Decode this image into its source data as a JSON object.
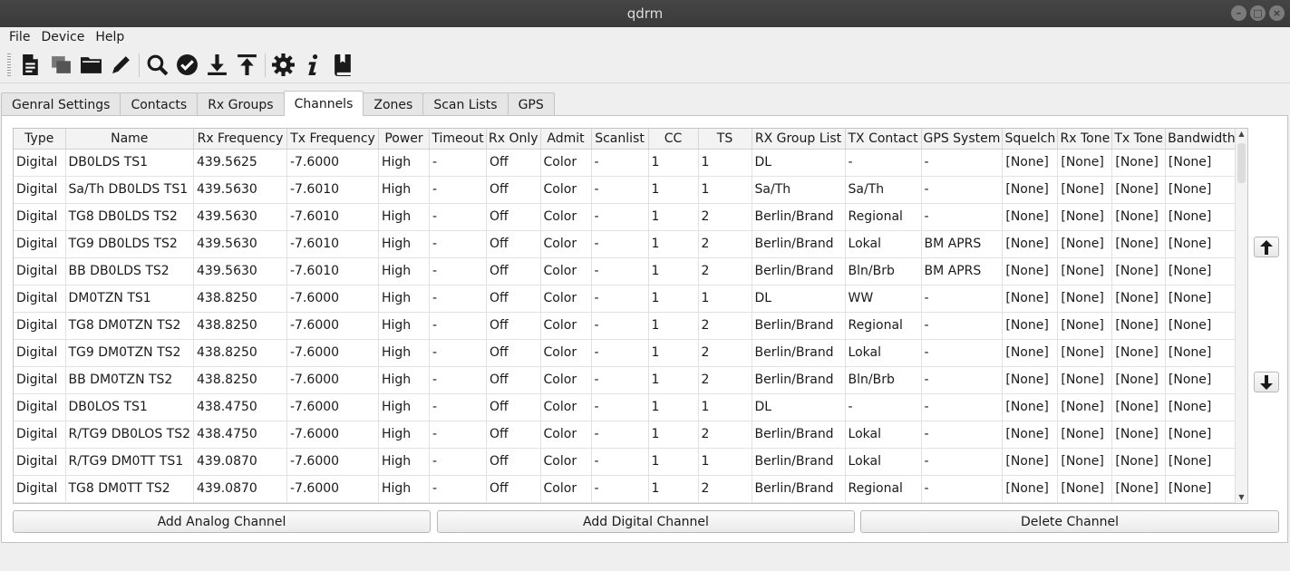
{
  "window": {
    "title": "qdrm"
  },
  "menu": {
    "items": [
      "File",
      "Device",
      "Help"
    ]
  },
  "toolbar": {
    "icons": [
      "new-document-icon",
      "copy-icon",
      "folder-open-icon",
      "pencil-icon",
      "search-icon",
      "check-circle-icon",
      "download-icon",
      "upload-icon",
      "gear-icon",
      "info-icon",
      "book-icon"
    ]
  },
  "tabs": [
    {
      "label": "Genral Settings",
      "active": false
    },
    {
      "label": "Contacts",
      "active": false
    },
    {
      "label": "Rx Groups",
      "active": false
    },
    {
      "label": "Channels",
      "active": true
    },
    {
      "label": "Zones",
      "active": false
    },
    {
      "label": "Scan Lists",
      "active": false
    },
    {
      "label": "GPS",
      "active": false
    }
  ],
  "table": {
    "columns": [
      "Type",
      "Name",
      "Rx Frequency",
      "Tx Frequency",
      "Power",
      "Timeout",
      "Rx Only",
      "Admit",
      "Scanlist",
      "CC",
      "TS",
      "RX Group List",
      "TX Contact",
      "GPS System",
      "Squelch",
      "Rx Tone",
      "Tx Tone",
      "Bandwidth"
    ],
    "rows": [
      [
        "Digital",
        "DB0LDS TS1",
        "439.5625",
        "-7.6000",
        "High",
        "-",
        "Off",
        "Color",
        "-",
        "1",
        "1",
        "DL",
        "-",
        "-",
        "[None]",
        "[None]",
        "[None]",
        "[None]"
      ],
      [
        "Digital",
        "Sa/Th DB0LDS TS1",
        "439.5630",
        "-7.6010",
        "High",
        "-",
        "Off",
        "Color",
        "-",
        "1",
        "1",
        "Sa/Th",
        "Sa/Th",
        "-",
        "[None]",
        "[None]",
        "[None]",
        "[None]"
      ],
      [
        "Digital",
        "TG8 DB0LDS TS2",
        "439.5630",
        "-7.6010",
        "High",
        "-",
        "Off",
        "Color",
        "-",
        "1",
        "2",
        "Berlin/Brand",
        "Regional",
        "-",
        "[None]",
        "[None]",
        "[None]",
        "[None]"
      ],
      [
        "Digital",
        "TG9 DB0LDS TS2",
        "439.5630",
        "-7.6010",
        "High",
        "-",
        "Off",
        "Color",
        "-",
        "1",
        "2",
        "Berlin/Brand",
        "Lokal",
        "BM APRS",
        "[None]",
        "[None]",
        "[None]",
        "[None]"
      ],
      [
        "Digital",
        "BB DB0LDS TS2",
        "439.5630",
        "-7.6010",
        "High",
        "-",
        "Off",
        "Color",
        "-",
        "1",
        "2",
        "Berlin/Brand",
        "Bln/Brb",
        "BM APRS",
        "[None]",
        "[None]",
        "[None]",
        "[None]"
      ],
      [
        "Digital",
        "DM0TZN TS1",
        "438.8250",
        "-7.6000",
        "High",
        "-",
        "Off",
        "Color",
        "-",
        "1",
        "1",
        "DL",
        "WW",
        "-",
        "[None]",
        "[None]",
        "[None]",
        "[None]"
      ],
      [
        "Digital",
        "TG8 DM0TZN TS2",
        "438.8250",
        "-7.6000",
        "High",
        "-",
        "Off",
        "Color",
        "-",
        "1",
        "2",
        "Berlin/Brand",
        "Regional",
        "-",
        "[None]",
        "[None]",
        "[None]",
        "[None]"
      ],
      [
        "Digital",
        "TG9 DM0TZN TS2",
        "438.8250",
        "-7.6000",
        "High",
        "-",
        "Off",
        "Color",
        "-",
        "1",
        "2",
        "Berlin/Brand",
        "Lokal",
        "-",
        "[None]",
        "[None]",
        "[None]",
        "[None]"
      ],
      [
        "Digital",
        "BB DM0TZN TS2",
        "438.8250",
        "-7.6000",
        "High",
        "-",
        "Off",
        "Color",
        "-",
        "1",
        "2",
        "Berlin/Brand",
        "Bln/Brb",
        "-",
        "[None]",
        "[None]",
        "[None]",
        "[None]"
      ],
      [
        "Digital",
        "DB0LOS TS1",
        "438.4750",
        "-7.6000",
        "High",
        "-",
        "Off",
        "Color",
        "-",
        "1",
        "1",
        "DL",
        "-",
        "-",
        "[None]",
        "[None]",
        "[None]",
        "[None]"
      ],
      [
        "Digital",
        "R/TG9 DB0LOS TS2",
        "438.4750",
        "-7.6000",
        "High",
        "-",
        "Off",
        "Color",
        "-",
        "1",
        "2",
        "Berlin/Brand",
        "Lokal",
        "-",
        "[None]",
        "[None]",
        "[None]",
        "[None]"
      ],
      [
        "Digital",
        "R/TG9 DM0TT TS1",
        "439.0870",
        "-7.6000",
        "High",
        "-",
        "Off",
        "Color",
        "-",
        "1",
        "1",
        "Berlin/Brand",
        "Lokal",
        "-",
        "[None]",
        "[None]",
        "[None]",
        "[None]"
      ],
      [
        "Digital",
        "TG8 DM0TT TS2",
        "439.0870",
        "-7.6000",
        "High",
        "-",
        "Off",
        "Color",
        "-",
        "1",
        "2",
        "Berlin/Brand",
        "Regional",
        "-",
        "[None]",
        "[None]",
        "[None]",
        "[None]"
      ]
    ]
  },
  "buttons": {
    "add_analog": "Add Analog Channel",
    "add_digital": "Add Digital Channel",
    "delete": "Delete Channel"
  },
  "colors": {
    "titlebar": "#3d3d3d",
    "active_tab": "#ffffff"
  }
}
